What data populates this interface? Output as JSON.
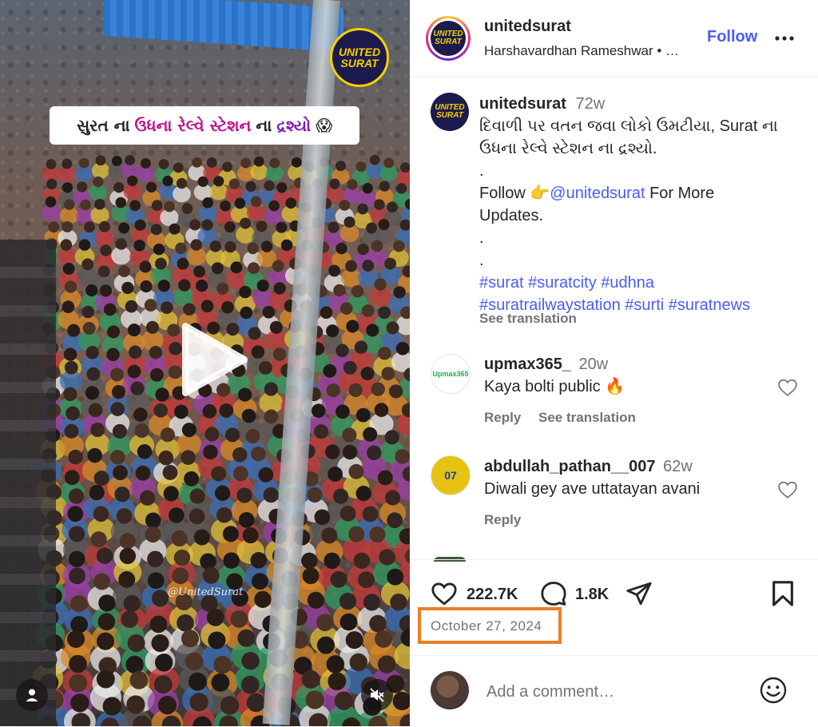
{
  "media": {
    "overlay_caption_part1": "સુરત ના",
    "overlay_caption_part2": "ઉધના રેલ્વે સ્ટેશન",
    "overlay_caption_part3": "ના",
    "overlay_caption_part4": "દ્રશ્યો",
    "overlay_emoji": "😱",
    "brand_badge": "UNITED SURAT",
    "watermark": "@UnitedSurat"
  },
  "header": {
    "username": "unitedsurat",
    "subline": "Harshavardhan Rameshwar  •  …",
    "follow_label": "Follow",
    "avatar_text": "UNITED SURAT"
  },
  "caption": {
    "username": "unitedsurat",
    "time": "72w",
    "line1": "દિવાળી પર વતન જવા લોકો ઉમટીયા, Surat ના",
    "line2": "ઉધના રેલ્વે સ્ટેશન ના દ્રશ્યો.",
    "dot1": ".",
    "follow_prefix": "Follow 👉",
    "follow_handle": "@unitedsurat",
    "follow_suffix": " For More",
    "updates": "Updates.",
    "dot2": ".",
    "dot3": ".",
    "hashtags_line1": "#surat #suratcity #udhna",
    "hashtags_line2": "#suratrailwaystation #surti #suratnews",
    "see_translation": "See translation"
  },
  "comments": [
    {
      "username": "upmax365_",
      "time": "20w",
      "text": "Kaya bolti public 🔥",
      "avatar_text": "Upmax365",
      "reply": "Reply",
      "see_translation": "See translation"
    },
    {
      "username": "abdullah_pathan__007",
      "time": "62w",
      "text": "Diwali gey ave uttatayan avani",
      "avatar_text": "07",
      "reply": "Reply"
    }
  ],
  "actions": {
    "likes": "222.7K",
    "comments": "1.8K"
  },
  "date": "October 27, 2024",
  "comment_box": {
    "placeholder": "Add a comment…"
  },
  "colors": {
    "link_blue": "#4a5df9",
    "highlight_orange": "#ee7d24",
    "brand_navy": "#1d1b4d",
    "brand_yellow": "#f4d000"
  }
}
